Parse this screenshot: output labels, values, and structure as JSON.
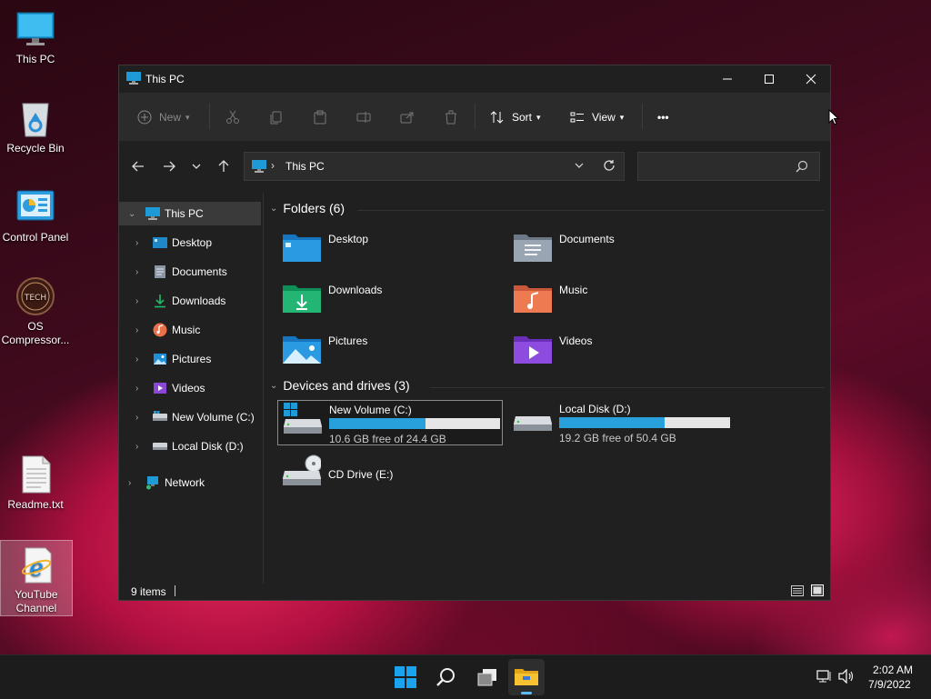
{
  "desktop": {
    "icons": [
      {
        "label": "This PC"
      },
      {
        "label": "Recycle Bin"
      },
      {
        "label": "Control Panel"
      },
      {
        "label": "OS Compressor..."
      },
      {
        "label": "Readme.txt"
      },
      {
        "label": "YouTube Channel"
      }
    ],
    "compressor_logo_text": "TECH"
  },
  "window": {
    "title": "This PC",
    "controls": {
      "minimize": "—",
      "maximize": "☐",
      "close": "✕"
    }
  },
  "toolbar": {
    "new_label": "New",
    "sort_label": "Sort",
    "view_label": "View",
    "more_label": "•••"
  },
  "address": {
    "path": "This PC",
    "search_placeholder": ""
  },
  "sidebar": {
    "items": [
      {
        "label": "This PC",
        "icon": "monitor-icon"
      },
      {
        "label": "Desktop",
        "icon": "desktop-icon"
      },
      {
        "label": "Documents",
        "icon": "documents-icon"
      },
      {
        "label": "Downloads",
        "icon": "download-icon"
      },
      {
        "label": "Music",
        "icon": "music-icon"
      },
      {
        "label": "Pictures",
        "icon": "pictures-icon"
      },
      {
        "label": "Videos",
        "icon": "videos-icon"
      },
      {
        "label": "New Volume (C:)",
        "icon": "drive-icon"
      },
      {
        "label": "Local Disk (D:)",
        "icon": "drive-icon"
      },
      {
        "label": "Network",
        "icon": "network-icon"
      }
    ]
  },
  "folders": {
    "header": "Folders (6)",
    "items": [
      {
        "label": "Desktop",
        "icon": "desktop-folder-icon"
      },
      {
        "label": "Documents",
        "icon": "documents-folder-icon"
      },
      {
        "label": "Downloads",
        "icon": "downloads-folder-icon"
      },
      {
        "label": "Music",
        "icon": "music-folder-icon"
      },
      {
        "label": "Pictures",
        "icon": "pictures-folder-icon"
      },
      {
        "label": "Videos",
        "icon": "videos-folder-icon"
      }
    ]
  },
  "drives": {
    "header": "Devices and drives (3)",
    "items": [
      {
        "label": "New Volume (C:)",
        "free": "10.6 GB free of 24.4 GB",
        "used_fraction": 0.566
      },
      {
        "label": "Local Disk (D:)",
        "free": "19.2 GB free of 50.4 GB",
        "used_fraction": 0.619
      },
      {
        "label": "CD Drive (E:)"
      }
    ]
  },
  "status": {
    "items_count": "9 items"
  },
  "taskbar": {
    "time": "2:02 AM",
    "date": "7/9/2022"
  },
  "colors": {
    "accent": "#27a0dc",
    "window_bg": "#202020",
    "toolbar_bg": "#2b2b2b"
  }
}
